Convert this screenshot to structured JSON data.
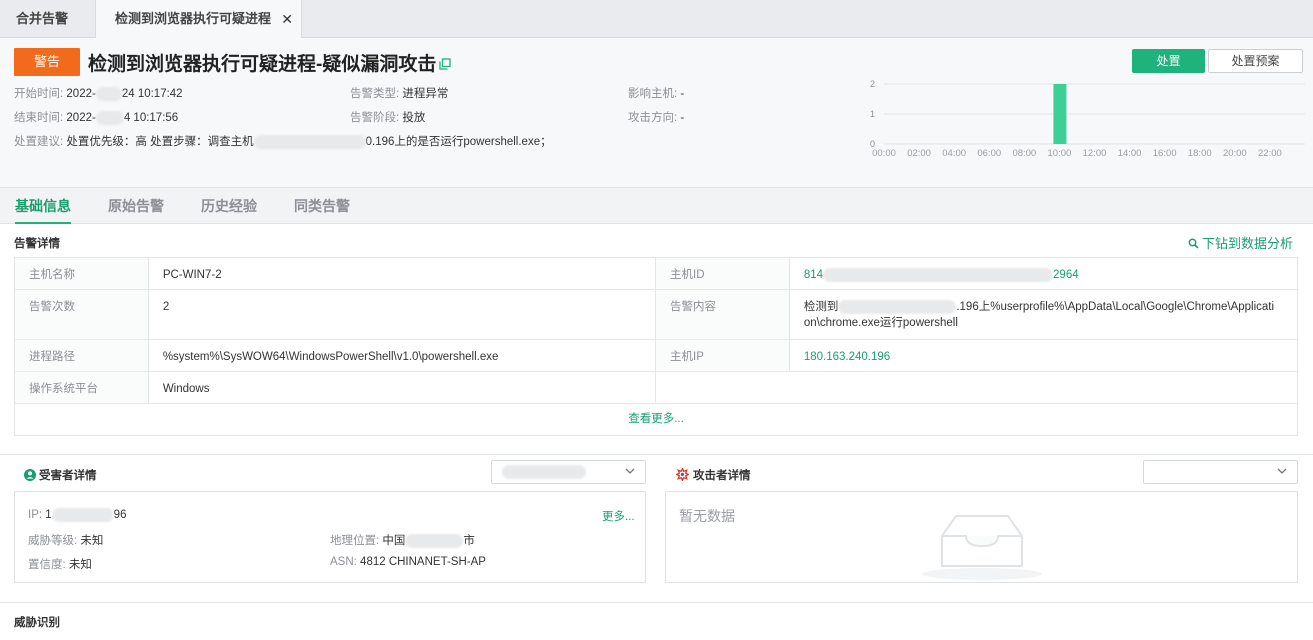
{
  "tabs": [
    {
      "label": "合并告警"
    },
    {
      "label": "检测到浏览器执行可疑进程"
    }
  ],
  "header": {
    "badge": "警告",
    "title": "检测到浏览器执行可疑进程-疑似漏洞攻击",
    "actions": {
      "primary": "处置",
      "secondary": "处置预案"
    },
    "start_label": "开始时间:",
    "start_value_a": "2022-",
    "start_value_b": "24 10:17:42",
    "end_label": "结束时间:",
    "end_value_a": "2022-",
    "end_value_b": "4 10:17:56",
    "type_label": "告警类型:",
    "type_value": "进程异常",
    "stage_label": "告警阶段:",
    "stage_value": "投放",
    "host_label": "影响主机:",
    "host_value": "-",
    "direction_label": "攻击方向:",
    "direction_value": "-",
    "advice_label": "处置建议:",
    "advice_value_a": "处置优先级：高 处置步骤：调查主机",
    "advice_value_b": "0.196上的是否运行powershell.exe；"
  },
  "chart_data": {
    "type": "bar",
    "x": [
      "00:00",
      "02:00",
      "04:00",
      "06:00",
      "08:00",
      "10:00",
      "12:00",
      "14:00",
      "16:00",
      "18:00",
      "20:00",
      "22:00"
    ],
    "values": [
      0,
      0,
      0,
      0,
      0,
      2,
      0,
      0,
      0,
      0,
      0,
      0
    ],
    "bar_at": "10:00",
    "yticks": [
      "0",
      "1",
      "2"
    ],
    "ylim": [
      0,
      2
    ],
    "color": "#3ccf96",
    "grid": true
  },
  "subtabs": [
    {
      "label": "基础信息"
    },
    {
      "label": "原始告警"
    },
    {
      "label": "历史经验"
    },
    {
      "label": "同类告警"
    }
  ],
  "details": {
    "title": "告警详情",
    "drill": "下钻到数据分析",
    "rows": [
      {
        "l1": "主机名称",
        "v1": "PC-WIN7-2",
        "l2": "主机ID",
        "v2a": "814",
        "v2b": "2964"
      },
      {
        "l1": "告警次数",
        "v1": "2",
        "l2": "告警内容",
        "v2a": "检测到",
        "v2b": ".196上%userprofile%\\AppData\\Local\\Google\\Chrome\\Applicati",
        "v2c": "on\\chrome.exe运行powershell"
      },
      {
        "l1": "进程路径",
        "v1": "%system%\\SysWOW64\\WindowsPowerShell\\v1.0\\powershell.exe",
        "l2": "主机IP",
        "v2a": "180.163.240.196"
      },
      {
        "l1": "操作系统平台",
        "v1": "Windows"
      }
    ],
    "more": "查看更多..."
  },
  "victim": {
    "title": "受害者详情",
    "more": "更多...",
    "ip_label": "IP:",
    "ip_a": "1",
    "ip_b": "96",
    "threat_label": "威胁等级:",
    "threat_value": "未知",
    "conf_label": "置信度:",
    "conf_value": "未知",
    "geo_label": "地理位置:",
    "geo_a": "中国",
    "geo_b": "市",
    "asn_label": "ASN:",
    "asn_value": "4812 CHINANET-SH-AP"
  },
  "attacker": {
    "title": "攻击者详情",
    "nodata": "暂无数据"
  },
  "footer": {
    "title": "威胁识别"
  },
  "colors": {
    "accent": "#1fb27c",
    "warning": "#f26a1b"
  }
}
